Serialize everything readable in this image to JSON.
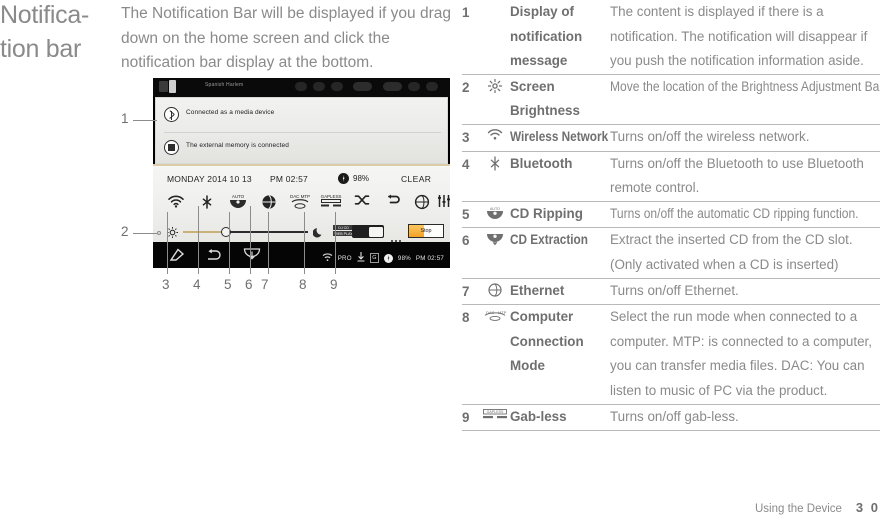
{
  "section": {
    "title": "Notifica-\ntion bar",
    "intro": "The Notification Bar will be displayed if you drag down on the home screen and click the notification bar display at the bottom."
  },
  "device_screenshot": {
    "home_title": "Spanish Harlem",
    "notifications": [
      {
        "icon": "bluetooth-circle-icon",
        "text": "Connected as a media device"
      },
      {
        "icon": "storage-circle-icon",
        "text": "The external memory is connected"
      }
    ],
    "quick_settings": {
      "date": "MONDAY 2014 10 13",
      "time": "PM 02:57",
      "battery": "98%",
      "clear_label": "CLEAR",
      "icons": [
        {
          "name": "wifi-icon",
          "label": ""
        },
        {
          "name": "bluetooth-icon",
          "label": ""
        },
        {
          "name": "cd-ripping-icon",
          "label": "AUTO"
        },
        {
          "name": "ethernet-globe-icon",
          "label": ""
        },
        {
          "name": "dac-mtp-icon",
          "label": "DAC MTP"
        },
        {
          "name": "gapless-icon",
          "label": "GAPLESS"
        },
        {
          "name": "shuffle-icon",
          "label": ""
        },
        {
          "name": "repeat-icon",
          "label": ""
        },
        {
          "name": "globe-clock-icon",
          "label": ""
        },
        {
          "name": "equalizer-icon",
          "label": ""
        }
      ],
      "brightness_tags": [
        "DJ CD",
        "WEB PLAY"
      ],
      "stop_button": "Stop"
    },
    "nav_bar": {
      "left_icons": [
        "home-icon",
        "back-icon",
        "cd-eject-icon"
      ],
      "status": {
        "wifi": "wifi-icon",
        "pro": "PRO",
        "download": "download-icon",
        "g_badge": "G",
        "battery": "98%",
        "time": "PM 02:57"
      }
    }
  },
  "callouts": {
    "side": [
      "1",
      "2"
    ],
    "bottom": [
      "3",
      "4",
      "5",
      "6",
      "7",
      "8",
      "9"
    ]
  },
  "table": {
    "rows": [
      {
        "num": "1",
        "icon": "",
        "label": "Display of notification message",
        "desc": "The content is displayed if there is a notification. The notification will disappear if you push the notification information aside."
      },
      {
        "num": "2",
        "icon": "brightness-icon",
        "label": "Screen Brightness",
        "desc": "Move the location of the Brightness Adjustment Bar to adjust the brightness of the screen.",
        "desc_tight": true
      },
      {
        "num": "3",
        "icon": "wifi-icon",
        "label": "Wireless Network",
        "label_tight": true,
        "desc": "Turns on/off the wireless network."
      },
      {
        "num": "4",
        "icon": "bluetooth-icon",
        "label": "Bluetooth",
        "desc": "Turns on/off the Bluetooth to use Bluetooth remote control."
      },
      {
        "num": "5",
        "icon": "cd-ripping-icon",
        "label": "CD Ripping",
        "desc": "Turns on/off the automatic CD ripping function.",
        "desc_tight": true
      },
      {
        "num": "6",
        "icon": "cd-extraction-icon",
        "label": "CD Extraction",
        "label_tight": true,
        "desc": "Extract the inserted CD from the CD slot. (Only activated when a CD is inserted)"
      },
      {
        "num": "7",
        "icon": "ethernet-globe-icon",
        "label": "Ethernet",
        "desc": "Turns on/off Ethernet."
      },
      {
        "num": "8",
        "icon": "dac-mtp-icon",
        "label": "Computer Connection Mode",
        "desc": "Select the run mode when connected to a computer. MTP: is connected to a computer, you can transfer media files. DAC: You can listen to music of PC via the product."
      },
      {
        "num": "9",
        "icon": "gapless-icon",
        "label": "Gab-less",
        "desc": "Turns on/off gab-less."
      }
    ]
  },
  "footer": {
    "chapter": "Using the Device",
    "page": "3 0"
  }
}
